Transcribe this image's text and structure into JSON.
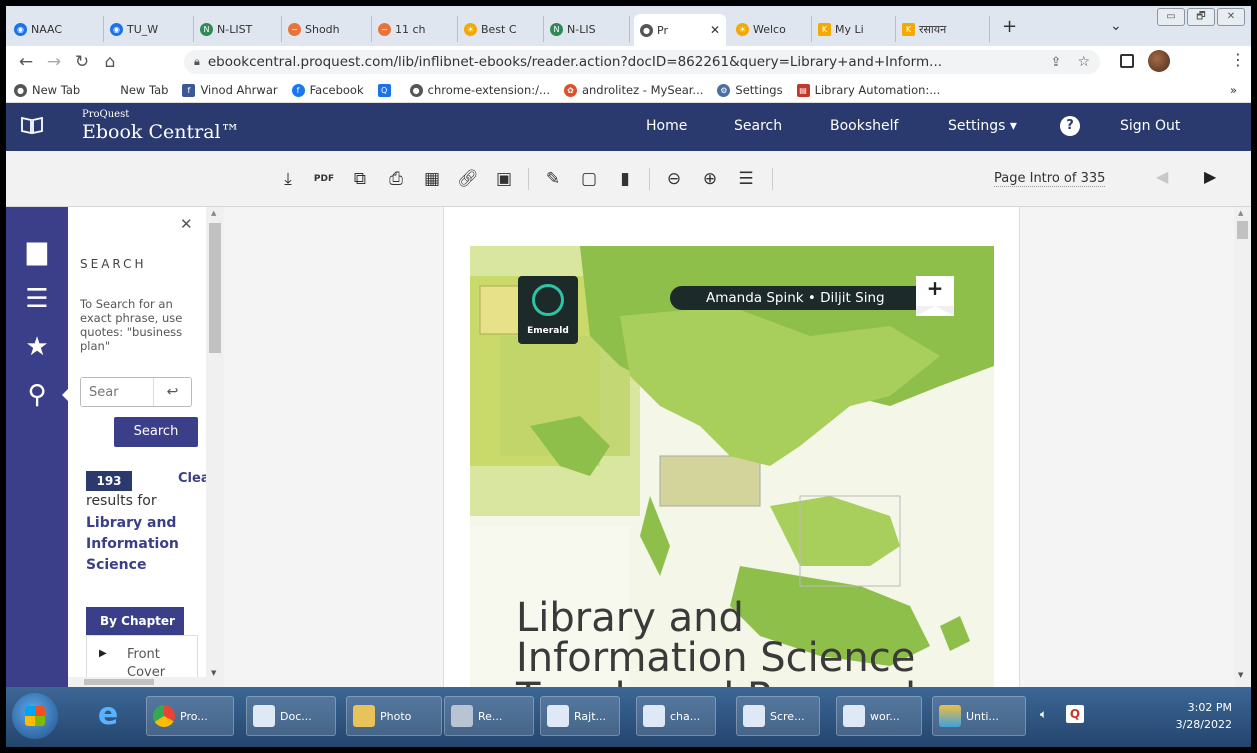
{
  "browser": {
    "tabs": [
      {
        "label": "NAAC",
        "color": "#1a73e8"
      },
      {
        "label": "TU_W",
        "color": "#1a73e8"
      },
      {
        "label": "N-LIST",
        "color": "#2e8b57"
      },
      {
        "label": "Shodh",
        "color": "#e8743b"
      },
      {
        "label": "11 ch",
        "color": "#e8743b"
      },
      {
        "label": "Best C",
        "color": "#f2a900"
      },
      {
        "label": "N-LIS",
        "color": "#2e8b57"
      },
      {
        "label": "Pr",
        "color": "#555555"
      },
      {
        "label": "Welco",
        "color": "#f2a900"
      },
      {
        "label": "My Li",
        "color": "#f2a900"
      },
      {
        "label": "रसायन",
        "color": "#f2a900"
      }
    ],
    "new_tab_symbol": "+",
    "tab_close_symbol": "✕",
    "tab_menu_symbol": "⌄",
    "window_buttons": [
      "▭",
      "🗗",
      "✕"
    ],
    "url": "ebookcentral.proquest.com/lib/inflibnet-ebooks/reader.action?docID=862261&query=Library+and+Inform...",
    "bookmarks": [
      {
        "label": "New Tab"
      },
      {
        "label": "New Tab"
      },
      {
        "label": "Vinod Ahrwar"
      },
      {
        "label": "Facebook"
      },
      {
        "label": ""
      },
      {
        "label": "chrome-extension:/..."
      },
      {
        "label": "androlitez - MySear..."
      },
      {
        "label": "Settings"
      },
      {
        "label": "Library Automation:..."
      }
    ],
    "bookmarks_more": "»"
  },
  "app": {
    "logo_small": "ProQuest",
    "logo_large": "Ebook Central™",
    "nav": [
      "Home",
      "Search",
      "Bookshelf",
      "Settings ▾",
      "Sign Out"
    ],
    "help_symbol": "?"
  },
  "toolbar": {
    "page_label": "Page Intro of 335",
    "tools": [
      "download",
      "pdf",
      "copy",
      "print",
      "add",
      "link",
      "comment",
      "highlight",
      "note",
      "bookmark",
      "zoom-out",
      "zoom-in",
      "view-options"
    ]
  },
  "search_panel": {
    "close_symbol": "✕",
    "title": "SEARCH",
    "hint": "To Search for an exact phrase, use quotes: \"business plan\"",
    "input_placeholder": "Sear",
    "enter_symbol": "↩",
    "search_button": "Search",
    "result_count": "193",
    "clear_label": "Clea",
    "results_for": "results for",
    "query": "Library and Information Science",
    "tab_label": "By Chapter",
    "tree_item": "Front Cover"
  },
  "book": {
    "publisher": "Emerald",
    "authors": "Amanda Spink • Diljit Sing",
    "title_line1": "Library and",
    "title_line2": "Information Science",
    "title_line3": "Trends and Research:"
  },
  "taskbar": {
    "items": [
      "Pro...",
      "Doc...",
      "Photo",
      "Re...",
      "Rajt...",
      "cha...",
      "Scre...",
      "wor...",
      "Unti..."
    ],
    "time": "3:02 PM",
    "date": "3/28/2022"
  }
}
